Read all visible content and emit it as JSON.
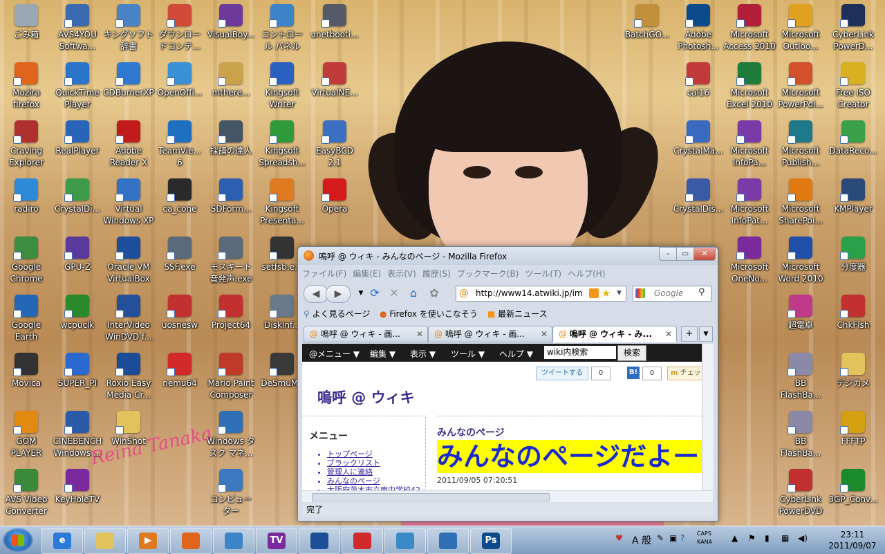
{
  "desktop": {
    "signature": "Reina Tanaka",
    "icons": [
      {
        "label": "ごみ箱",
        "icon": "recycle-bin-icon",
        "color": "#9aa7b5"
      },
      {
        "label": "AVS4YOU\nSoftwa...",
        "icon": "avs4you-icon",
        "color": "#3a6bb0"
      },
      {
        "label": "キングソフト\n辞書",
        "icon": "kingsoft-dictionary-icon",
        "color": "#4a83c5"
      },
      {
        "label": "ダウンロー\nドコンテ...",
        "icon": "download-contents-icon",
        "color": "#d24a3a"
      },
      {
        "label": "VisualBoy...",
        "icon": "visualboy-icon",
        "color": "#6d3a9c"
      },
      {
        "label": "コントロー\nル パネル",
        "icon": "control-panel-icon",
        "color": "#3b84c8"
      },
      {
        "label": "unetbooti...",
        "icon": "unetbootin-icon",
        "color": "#555b66"
      },
      {
        "label": "Mozira\nfirefox",
        "icon": "firefox-icon",
        "color": "#e0641c"
      },
      {
        "label": "QuickTime\nPlayer",
        "icon": "quicktime-icon",
        "color": "#2a74c9"
      },
      {
        "label": "CDBurnerXP",
        "icon": "cdburnerxp-icon",
        "color": "#2f7ad0"
      },
      {
        "label": "OpenOffi...",
        "icon": "openoffice-icon",
        "color": "#3b8fd4"
      },
      {
        "label": "mthere...",
        "icon": "mthere-icon",
        "color": "#c9a24a"
      },
      {
        "label": "Kingsoft\nWriter",
        "icon": "kingsoft-writer-icon",
        "color": "#2a60c0"
      },
      {
        "label": "VirtualNE...",
        "icon": "virtualnes-icon",
        "color": "#c23b3b"
      },
      {
        "label": "Craving\nExplorer",
        "icon": "craving-explorer-icon",
        "color": "#b03030"
      },
      {
        "label": "RealPlayer",
        "icon": "realplayer-icon",
        "color": "#2865b8"
      },
      {
        "label": "Adobe\nReader X",
        "icon": "adobe-reader-icon",
        "color": "#c21b1b"
      },
      {
        "label": "TeamVie...\n6",
        "icon": "teamviewer-icon",
        "color": "#1f6fc0"
      },
      {
        "label": "採譜の達人",
        "icon": "saifu-tatsujin-icon",
        "color": "#445566"
      },
      {
        "label": "Kingsoft\nSpreadsh...",
        "icon": "kingsoft-spreadsheet-icon",
        "color": "#2f9a3a"
      },
      {
        "label": "EasyBCD\n2.1",
        "icon": "easybcd-icon",
        "color": "#3b6fc2"
      },
      {
        "label": "radiro",
        "icon": "radiro-icon",
        "color": "#2c8ad8"
      },
      {
        "label": "CrystalDi...",
        "icon": "crystaldisk-icon",
        "color": "#3c9a4a"
      },
      {
        "label": "Virtual\nWindows XP",
        "icon": "virtual-xp-icon",
        "color": "#3372c4"
      },
      {
        "label": "ca_cone",
        "icon": "ca-cone-icon",
        "color": "#2a2a2a"
      },
      {
        "label": "SDForm...",
        "icon": "sdformatter-icon",
        "color": "#2c5fb0"
      },
      {
        "label": "Kingsoft\nPresenta...",
        "icon": "kingsoft-presentation-icon",
        "color": "#e07a20"
      },
      {
        "label": "Opera",
        "icon": "opera-icon",
        "color": "#d41a1a"
      },
      {
        "label": "Google\nChrome",
        "icon": "chrome-icon",
        "color": "#3c8d3f"
      },
      {
        "label": "GPU-Z",
        "icon": "gpuz-icon",
        "color": "#5a3a9c"
      },
      {
        "label": "Oracle VM\nVirtualBox",
        "icon": "virtualbox-icon",
        "color": "#1d4e9a"
      },
      {
        "label": "SSF.exe",
        "icon": "ssf-icon",
        "color": "#5a6a7a"
      },
      {
        "label": "モスキート\n音発声.exe",
        "icon": "mosquito-icon",
        "color": "#5a6a7a"
      },
      {
        "label": "setfsb.e...",
        "icon": "setfsb-icon",
        "color": "#333333"
      },
      {
        "label": "Google\nEarth",
        "icon": "google-earth-icon",
        "color": "#2467b5"
      },
      {
        "label": "wcpuclk",
        "icon": "wcpuclk-icon",
        "color": "#2a8a2a"
      },
      {
        "label": "InterVideo\nWinDVD f...",
        "icon": "windvd-icon",
        "color": "#244f9a"
      },
      {
        "label": "uosnesw",
        "icon": "uosnesw-icon",
        "color": "#c23030"
      },
      {
        "label": "Project64",
        "icon": "project64-icon",
        "color": "#c23030"
      },
      {
        "label": "DiskInf...",
        "icon": "diskinfo-icon",
        "color": "#6a7a8a"
      },
      {
        "label": "Movica",
        "icon": "movica-icon",
        "color": "#333333"
      },
      {
        "label": "SUPER_PI",
        "icon": "superpi-icon",
        "color": "#2a6ad0"
      },
      {
        "label": "Roxio Easy\nMedia Cr...",
        "icon": "roxio-icon",
        "color": "#1c4b98"
      },
      {
        "label": "nemu64",
        "icon": "nemu64-icon",
        "color": "#d22a2a"
      },
      {
        "label": "Mario Paint\nComposer",
        "icon": "mario-paint-icon",
        "color": "#c03a2a"
      },
      {
        "label": "DeSmuMe",
        "icon": "desmume-icon",
        "color": "#3a3a3a"
      },
      {
        "label": "GOM\nPLAYER",
        "icon": "gom-player-icon",
        "color": "#e08a10"
      },
      {
        "label": "CINEBENCH\nWindows ...",
        "icon": "cinebench-icon",
        "color": "#2a5aa8"
      },
      {
        "label": "WinShot",
        "icon": "winshot-folder-icon",
        "color": "#e2c25a"
      },
      {
        "label": "Windows タ\nスク マネ...",
        "icon": "task-manager-icon",
        "color": "#2f6fb5"
      },
      {
        "label": "AVS Video\nConverter",
        "icon": "avs-converter-icon",
        "color": "#3a8a3a"
      },
      {
        "label": "KeyHoleTV",
        "icon": "keyholetv-icon",
        "color": "#7a2a9c"
      },
      {
        "label": "コンピュー\nター",
        "icon": "computer-icon",
        "color": "#3c78c0"
      },
      {
        "label": "BatchGO...",
        "icon": "batchgo-icon",
        "color": "#c2903a"
      },
      {
        "label": "Adobe\nPhotosh...",
        "icon": "photoshop-icon",
        "color": "#0d4a8c"
      },
      {
        "label": "Microsoft\nAccess 2010",
        "icon": "access-icon",
        "color": "#b31f3a"
      },
      {
        "label": "Microsoft\nOutloo...",
        "icon": "outlook-icon",
        "color": "#e0a020"
      },
      {
        "label": "CyberLink\nPowerD...",
        "icon": "cyberlink-powerdvd-icon",
        "color": "#1e2f5a"
      },
      {
        "label": "cal16",
        "icon": "cal16-icon",
        "color": "#c23a3a"
      },
      {
        "label": "Microsoft\nExcel 2010",
        "icon": "excel-icon",
        "color": "#1e7b3a"
      },
      {
        "label": "Microsoft\nPowerPoi...",
        "icon": "powerpoint-icon",
        "color": "#d2502a"
      },
      {
        "label": "Free ISO\nCreator",
        "icon": "free-iso-icon",
        "color": "#d8b020"
      },
      {
        "label": "CrystalMa...",
        "icon": "crystalmark-icon",
        "color": "#3a6ac0"
      },
      {
        "label": "Microsoft\nInfoPa...",
        "icon": "infopath-icon",
        "color": "#7a3aa8"
      },
      {
        "label": "Microsoft\nPublish...",
        "icon": "publisher-icon",
        "color": "#1e7a8a"
      },
      {
        "label": "DataReco...",
        "icon": "datarecovery-icon",
        "color": "#3aa04a"
      },
      {
        "label": "CrystalDis...",
        "icon": "crystaldiskmark-icon",
        "color": "#3a5aa8"
      },
      {
        "label": "Microsoft\nInfoPat...",
        "icon": "infopath-filler-icon",
        "color": "#7a3aa8"
      },
      {
        "label": "Microsoft\nSharePoi...",
        "icon": "sharepoint-icon",
        "color": "#e07a10"
      },
      {
        "label": "KMPlayer",
        "icon": "kmplayer-icon",
        "color": "#2a4a7a"
      },
      {
        "label": "Microsoft\nOneNo...",
        "icon": "onenote-icon",
        "color": "#7a2a9a"
      },
      {
        "label": "Microsoft\nWord 2010",
        "icon": "word-icon",
        "color": "#1f4fa8"
      },
      {
        "label": "分度器",
        "icon": "protractor-icon",
        "color": "#2aa04a"
      },
      {
        "label": "超電卓",
        "icon": "calculator-icon",
        "color": "#c03a8a"
      },
      {
        "label": "ChkFlsh",
        "icon": "chkflsh-icon",
        "color": "#c23030"
      },
      {
        "label": "BB\nFlashBa...",
        "icon": "bb-flashback-icon",
        "color": "#8a8aa8"
      },
      {
        "label": "デジカメ",
        "icon": "camera-folder-icon",
        "color": "#e2c25a"
      },
      {
        "label": "BB\nFlashBa...",
        "icon": "bb-flashback-player-icon",
        "color": "#8a8aa8"
      },
      {
        "label": "FFFTP",
        "icon": "ffftp-icon",
        "color": "#d2a010"
      },
      {
        "label": "CyberLink\nPowerDVD",
        "icon": "powerdvd-icon",
        "color": "#c23030"
      },
      {
        "label": "3GP_Conv...",
        "icon": "3gp-converter-icon",
        "color": "#1a8a2a"
      }
    ]
  },
  "firefox": {
    "title": "嗚呼 @ ウィキ - みんなのページ - Mozilla Firefox",
    "menu": [
      "ファイル(F)",
      "編集(E)",
      "表示(V)",
      "履歴(S)",
      "ブックマーク(B)",
      "ツール(T)",
      "ヘルプ(H)"
    ],
    "url": "http://www14.atwiki.jp/im",
    "search_placeholder": "Google",
    "bookmarks": [
      "よく見るページ",
      "Firefox を使いこなそう",
      "最新ニュース"
    ],
    "tabs": [
      {
        "label": "嗚呼 @ ウィキ - 画...",
        "active": false
      },
      {
        "label": "嗚呼 @ ウィキ - 画...",
        "active": false
      },
      {
        "label": "嗚呼 @ ウィキ - み...",
        "active": true
      }
    ],
    "status": "完了"
  },
  "wiki": {
    "topbar": [
      "@メニュー ▼",
      "編集 ▼",
      "表示 ▼",
      "ツール ▼",
      "ヘルプ ▼"
    ],
    "search_value": "wiki内検索",
    "search_button": "検索",
    "tweet_label": "ツイートする",
    "tweet_count": "0",
    "hatena_label": "B!",
    "hatena_count": "0",
    "mixi_label": "チェック",
    "site_title": "嗚呼 @ ウィキ",
    "menu_heading": "メニュー",
    "menu_items": [
      "トップページ",
      "ブラックリスト",
      "管理人に連絡",
      "みんなのページ",
      "大阪府茨木市立南中学校42"
    ],
    "page_name": "みんなのページ",
    "headline": "みんなのページだよー",
    "date": "2011/09/05 07:20:51"
  },
  "taskbar": {
    "buttons": [
      {
        "name": "taskbar-ie",
        "icon": "ie-icon",
        "glyph": "e",
        "color": "#2a7ad8"
      },
      {
        "name": "taskbar-explorer",
        "icon": "explorer-folder-icon",
        "glyph": "",
        "color": "#e2c25a"
      },
      {
        "name": "taskbar-media",
        "icon": "media-player-icon",
        "glyph": "▶",
        "color": "#e07a20"
      },
      {
        "name": "taskbar-firefox",
        "icon": "firefox-icon",
        "glyph": "",
        "color": "#e0641c"
      },
      {
        "name": "taskbar-control",
        "icon": "control-panel-icon",
        "glyph": "",
        "color": "#3b84c8"
      },
      {
        "name": "taskbar-keyhole",
        "icon": "keyholetv-icon",
        "glyph": "TV",
        "color": "#7a2a9c"
      },
      {
        "name": "taskbar-virtualbox",
        "icon": "virtualbox-icon",
        "glyph": "",
        "color": "#1d4e9a"
      },
      {
        "name": "taskbar-mario",
        "icon": "mario-icon",
        "glyph": "",
        "color": "#d22a2a"
      },
      {
        "name": "taskbar-photos",
        "icon": "photo-viewer-icon",
        "glyph": "",
        "color": "#3a8ac8"
      },
      {
        "name": "taskbar-taskmgr",
        "icon": "task-manager-icon",
        "glyph": "",
        "color": "#2f6fb5"
      },
      {
        "name": "taskbar-photoshop",
        "icon": "photoshop-icon",
        "glyph": "Ps",
        "color": "#0d4a8c"
      }
    ],
    "ime": "A 般",
    "caps": "CAPS",
    "kana": "KANA",
    "time": "23:11",
    "date": "2011/09/07"
  }
}
